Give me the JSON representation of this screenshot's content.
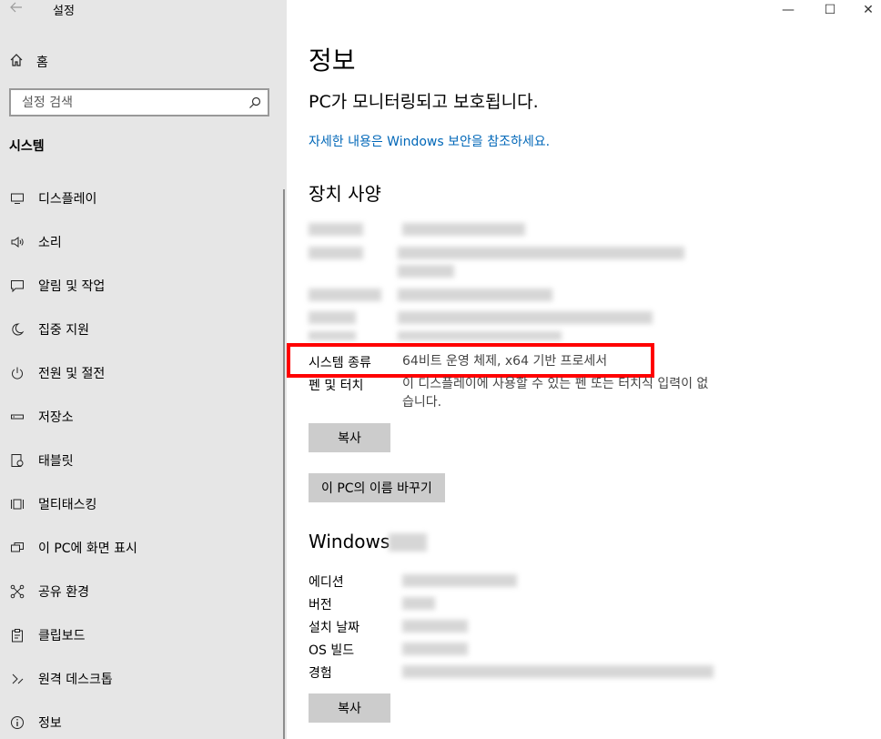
{
  "window": {
    "title": "설정",
    "controls": {
      "minimize": "—",
      "maximize": "☐",
      "close": "✕"
    }
  },
  "sidebar": {
    "home_label": "홈",
    "search_placeholder": "설정 검색",
    "section_header": "시스템",
    "items": [
      {
        "label": "디스플레이",
        "icon": "display-icon"
      },
      {
        "label": "소리",
        "icon": "speaker-icon"
      },
      {
        "label": "알림 및 작업",
        "icon": "notification-icon"
      },
      {
        "label": "집중 지원",
        "icon": "moon-icon"
      },
      {
        "label": "전원 및 절전",
        "icon": "power-icon"
      },
      {
        "label": "저장소",
        "icon": "storage-icon"
      },
      {
        "label": "태블릿",
        "icon": "tablet-icon"
      },
      {
        "label": "멀티태스킹",
        "icon": "multitasking-icon"
      },
      {
        "label": "이 PC에 화면 표시",
        "icon": "project-icon"
      },
      {
        "label": "공유 환경",
        "icon": "share-icon"
      },
      {
        "label": "클립보드",
        "icon": "clipboard-icon"
      },
      {
        "label": "원격 데스크톱",
        "icon": "remote-icon"
      },
      {
        "label": "정보",
        "icon": "info-icon"
      }
    ]
  },
  "main": {
    "title": "정보",
    "protect_text": "PC가 모니터링되고 보호됩니다.",
    "security_link": "자세한 내용은 Windows 보안을 참조하세요.",
    "device_spec_title": "장치 사양",
    "system_type_label": "시스템 종류",
    "system_type_value": "64비트 운영 체제, x64 기반 프로세서",
    "pen_touch_label": "펜 및 터치",
    "pen_touch_value": "이 디스플레이에 사용할 수 있는 펜 또는 터치식 입력이 없습니다.",
    "copy_button": "복사",
    "rename_button": "이 PC의 이름 바꾸기",
    "windows_heading": "Windows",
    "windows_labels": [
      "에디션",
      "버전",
      "설치 날짜",
      "OS 빌드",
      "경험"
    ],
    "copy_button_2": "복사"
  },
  "colors": {
    "link": "#0067b8",
    "highlight": "#ff0000",
    "sidebar_bg": "#e6e6e6",
    "button_bg": "#cccccc"
  }
}
